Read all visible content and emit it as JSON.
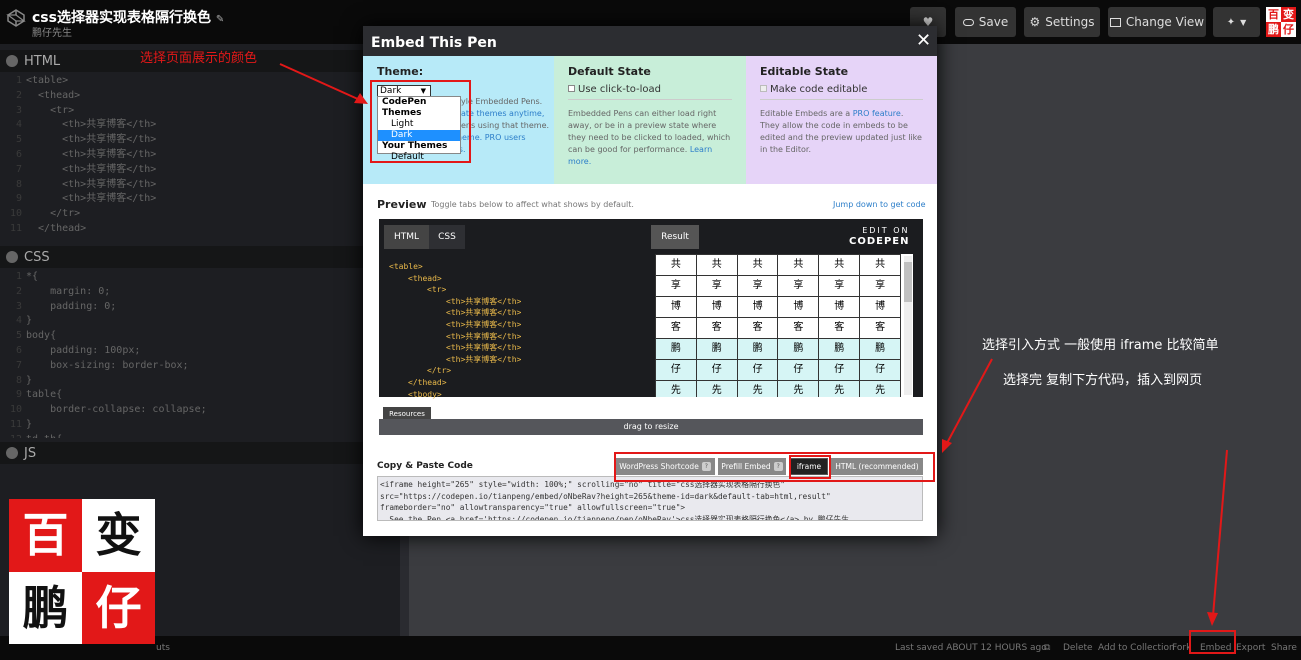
{
  "topbar": {
    "pen_title": "css选择器实现表格隔行换色",
    "author": "鹏仔先生",
    "buttons": {
      "heart": "♥",
      "save": "Save",
      "settings": "Settings",
      "change_view": "Change View",
      "pin": "📌"
    }
  },
  "brand": {
    "chars": [
      "百",
      "变",
      "鹏",
      "仔"
    ]
  },
  "panels": {
    "html_label": "HTML",
    "css_label": "CSS",
    "js_label": "JS",
    "html_code": [
      "<table>",
      "  <thead>",
      "    <tr>",
      "      <th>共享博客</th>",
      "      <th>共享博客</th>",
      "      <th>共享博客</th>",
      "      <th>共享博客</th>",
      "      <th>共享博客</th>",
      "      <th>共享博客</th>",
      "    </tr>",
      "  </thead>"
    ],
    "css_code": [
      "*{",
      "    margin: 0;",
      "    padding: 0;",
      "}",
      "body{",
      "    padding: 100px;",
      "    box-sizing: border-box;",
      "}",
      "table{",
      "    border-collapse: collapse;",
      "}",
      "td,th{"
    ]
  },
  "bottombar": {
    "last_saved": "Last saved ABOUT 12 HOURS ago",
    "links": [
      "Delete",
      "Add to Collection",
      "Fork",
      "Embed",
      "Export",
      "Share"
    ],
    "left_fragment": "uts"
  },
  "modal": {
    "title": "Embed This Pen",
    "close": "✕",
    "theme": {
      "heading": "Theme:",
      "selected": "Dark",
      "text_1": "yle Embedded Pens.",
      "text_2": "ate themes anytime,",
      "text_3": "ens using that theme.",
      "text_4": "Free users get one theme. PRO users get unlimited themes.",
      "dropdown": [
        {
          "label": "CodePen Themes",
          "kind": "group"
        },
        {
          "label": "Light",
          "kind": "option"
        },
        {
          "label": "Dark",
          "kind": "selected"
        },
        {
          "label": "Your Themes",
          "kind": "group"
        },
        {
          "label": "Default",
          "kind": "option"
        }
      ]
    },
    "default_state": {
      "heading": "Default State",
      "checkbox": "Use click-to-load",
      "text": "Embedded Pens can either load right away, or be in a preview state where they need to be clicked to loaded, which can be good for performance.",
      "link": "Learn more."
    },
    "editable_state": {
      "heading": "Editable State",
      "checkbox": "Make code editable",
      "text_a": "Editable Embeds are a",
      "link": "PRO feature",
      "text_b": ". They allow the code in embeds to be edited and the preview updated just like in the Editor."
    },
    "preview": {
      "title": "Preview",
      "subtitle": "Toggle tabs below to affect what shows by default.",
      "jump": "Jump down to get code",
      "tabs": {
        "html": "HTML",
        "css": "CSS",
        "result": "Result"
      },
      "edit_on": "EDIT ON",
      "codepen": "CODEPEN",
      "code_lines": [
        {
          "indent": 0,
          "tag": "<table>"
        },
        {
          "indent": 1,
          "tag": "<thead>"
        },
        {
          "indent": 2,
          "tag": "<tr>"
        },
        {
          "indent": 3,
          "tag": "<th>共享博客</th>"
        },
        {
          "indent": 3,
          "tag": "<th>共享博客</th>"
        },
        {
          "indent": 3,
          "tag": "<th>共享博客</th>"
        },
        {
          "indent": 3,
          "tag": "<th>共享博客</th>"
        },
        {
          "indent": 3,
          "tag": "<th>共享博客</th>"
        },
        {
          "indent": 3,
          "tag": "<th>共享博客</th>"
        },
        {
          "indent": 2,
          "tag": "</tr>"
        },
        {
          "indent": 1,
          "tag": "</thead>"
        },
        {
          "indent": 1,
          "tag": "<tbody>"
        }
      ],
      "result_head": [
        "共",
        "享",
        "博",
        "客"
      ],
      "result_body": [
        "鹏",
        "仔",
        "先"
      ],
      "resources": "Resources",
      "drag": "drag to resize"
    },
    "copy": {
      "title": "Copy & Paste Code",
      "tabs": [
        "WordPress Shortcode",
        "Prefill Embed",
        "iframe",
        "HTML (recommended)"
      ],
      "code": [
        "<iframe height=\"265\" style=\"width: 100%;\" scrolling=\"no\" title=\"css选择器实现表格隔行换色\"",
        "src=\"https://codepen.io/tianpeng/embed/oNbeRav?height=265&theme-id=dark&default-tab=html,result\"",
        "frameborder=\"no\" allowtransparency=\"true\" allowfullscreen=\"true\">",
        "  See the Pen <a href='https://codepen.io/tianpeng/pen/oNbeRav'>css选择器实现表格隔行换色</a> by 鹏仔先生"
      ]
    }
  },
  "annotations": {
    "choose_color": "选择页面展示的颜色",
    "choose_method": "选择引入方式  一般使用 iframe 比较简单",
    "copy_hint": "选择完  复制下方代码，插入到网页"
  }
}
